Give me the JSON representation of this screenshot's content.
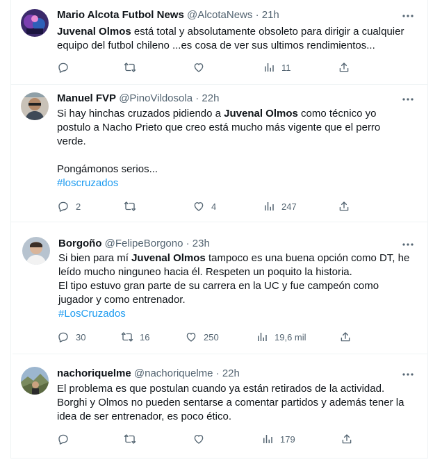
{
  "tweets": [
    {
      "name": "Mario Alcota Futbol News",
      "handle": "@AlcotaNews",
      "dot": "·",
      "time": "21h",
      "lines": [
        [
          "",
          "Juvenal Olmos",
          " está total y absolutamente obsoleto para dirigir a cualquier"
        ],
        [
          "equipo del futbol chileno ...es cosa de ver sus ultimos rendimientos..."
        ]
      ],
      "replies": "",
      "retweets": "",
      "likes": "",
      "views": "11"
    },
    {
      "name": "Manuel FVP",
      "handle": "@PinoVildosola",
      "dot": "·",
      "time": "22h",
      "lines": [
        [
          "Si hay hinchas cruzados pidiendo a ",
          "Juvenal Olmos",
          " como técnico yo"
        ],
        [
          "postulo a Nacho Prieto que creo está mucho más vigente que el perro"
        ],
        [
          "verde."
        ],
        [
          ""
        ],
        [
          "Pongámonos serios..."
        ]
      ],
      "hashtag": "#loscruzados",
      "replies": "2",
      "retweets": "",
      "likes": "4",
      "views": "247"
    },
    {
      "name": "Borgoño",
      "handle": "@FelipeBorgono",
      "dot": "·",
      "time": "23h",
      "lines": [
        [
          "Si bien para mí ",
          "Juvenal Olmos",
          " tampoco es una buena opción como DT, he"
        ],
        [
          "leído mucho ninguneo hacia él. Respeten un poquito la historia."
        ],
        [
          "El tipo estuvo gran parte de su carrera en la UC y fue campeón como"
        ],
        [
          "jugador y como entrenador."
        ]
      ],
      "hashtag": "#LosCruzados",
      "replies": "30",
      "retweets": "16",
      "likes": "250",
      "views": "19,6 mil"
    },
    {
      "name": "nachoriquelme",
      "handle": "@nachoriquelme",
      "dot": "·",
      "time": "22h",
      "lines": [
        [
          "El problema es que postulan cuando ya están retirados de la actividad."
        ],
        [
          "Borghi y Olmos no pueden sentarse a comentar partidos y además tener la"
        ],
        [
          "idea de ser entrenador, es poco ético."
        ]
      ],
      "replies": "",
      "retweets": "",
      "likes": "",
      "views": "179"
    }
  ],
  "icons": {
    "more": "more-horizontal-icon",
    "reply": "reply-icon",
    "retweet": "retweet-icon",
    "like": "heart-icon",
    "views": "views-chart-icon",
    "share": "share-icon"
  },
  "colors": {
    "text": "#0f1419",
    "muted": "#536471",
    "link": "#1d9bf0",
    "border": "#eff3f4"
  }
}
